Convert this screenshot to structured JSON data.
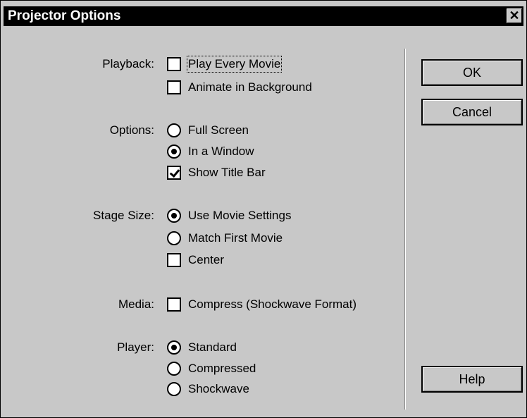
{
  "dialog": {
    "title": "Projector Options",
    "close_glyph": "✕"
  },
  "sections": {
    "playback": {
      "label": "Playback:",
      "play_every_movie": {
        "label": "Play Every Movie",
        "checked": false
      },
      "animate_in_background": {
        "label": "Animate in Background",
        "checked": false
      }
    },
    "options": {
      "label": "Options:",
      "full_screen": {
        "label": "Full Screen",
        "selected": false
      },
      "in_a_window": {
        "label": "In a Window",
        "selected": true
      },
      "show_title_bar": {
        "label": "Show Title Bar",
        "checked": true
      }
    },
    "stage_size": {
      "label": "Stage Size:",
      "use_movie_settings": {
        "label": "Use Movie Settings",
        "selected": true
      },
      "match_first_movie": {
        "label": "Match First Movie",
        "selected": false
      },
      "center": {
        "label": "Center",
        "checked": false
      }
    },
    "media": {
      "label": "Media:",
      "compress": {
        "label": "Compress (Shockwave Format)",
        "checked": false
      }
    },
    "player": {
      "label": "Player:",
      "standard": {
        "label": "Standard",
        "selected": true
      },
      "compressed": {
        "label": "Compressed",
        "selected": false
      },
      "shockwave": {
        "label": "Shockwave",
        "selected": false
      }
    }
  },
  "buttons": {
    "ok": "OK",
    "cancel": "Cancel",
    "help": "Help"
  },
  "icons": {
    "close": "close-icon"
  }
}
